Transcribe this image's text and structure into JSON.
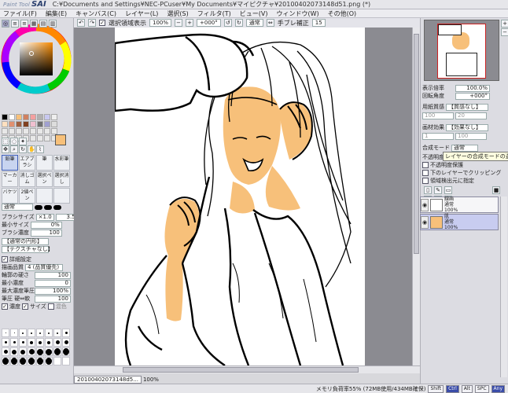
{
  "titlebar": {
    "logo_small": "Paint Tool",
    "logo_big": "SAI",
    "path": "C:¥Documents and Settings¥NEC-PCuser¥My Documents¥マイピクチャ¥20100402073148d51.png (*)"
  },
  "menu": [
    "ファイル(F)",
    "編集(E)",
    "キャンバス(C)",
    "レイヤー(L)",
    "選択(S)",
    "フィルタ(T)",
    "ビュー(V)",
    "ウィンドウ(W)",
    "その他(O)"
  ],
  "toolbar": {
    "selection_display_label": "選択領域表示",
    "zoom": "100%",
    "rotation": "+000°",
    "mode": "通常",
    "stabilizer_label": "手ブレ補正",
    "stabilizer_value": "15"
  },
  "left": {
    "brush_shape_label": "通常",
    "brush_size_label": "ブラシサイズ",
    "brush_size_mult": "×1.0",
    "brush_size_value": "3.5",
    "min_size_label": "最小サイズ",
    "min_size_value": "0%",
    "brush_density_label": "ブラシ濃度",
    "brush_density_value": "100",
    "texture_1": "【通常の円形】",
    "texture_2": "【テクスチャなし】",
    "detail_label": "詳細設定",
    "quality_label": "描画品質",
    "quality_value": "4 (品質優先)",
    "edge_label": "輪郭の硬さ",
    "edge_value": "100",
    "min_density_label": "最小濃度",
    "min_density_value": "0",
    "max_density_label": "最大濃度筆圧",
    "max_density_value": "100%",
    "pressure_label": "筆圧 硬⇔軟",
    "pressure_value": "100",
    "pressure_density": "濃度",
    "pressure_size": "サイズ",
    "pressure_blend": "混色",
    "tools": [
      "鉛筆",
      "エアブラシ",
      "筆",
      "水彩筆",
      "マーカー",
      "消しゴム",
      "選択ペン",
      "選択消し",
      "バケツ",
      "2値ペン",
      "",
      ""
    ],
    "brush_sizes": [
      "0.7",
      "0.8",
      "1",
      "1.5",
      "2",
      "2.3",
      "2.6",
      "3",
      "3.5",
      "4",
      "5",
      "6",
      "7",
      "8",
      "9",
      "10",
      "12",
      "14",
      "16",
      "20",
      "25",
      "30",
      "35",
      "40",
      "50",
      "60",
      "70",
      "80",
      "100",
      "120",
      "",
      ""
    ]
  },
  "right": {
    "zoom_label": "表示倍率",
    "zoom_value": "100.0%",
    "angle_label": "回転角度",
    "angle_value": "+000°",
    "texture_label": "用紙質感",
    "texture_value": "【質感なし】",
    "effect_label": "画材効果",
    "effect_value": "【効果なし】",
    "blend_label": "合成モード",
    "blend_value": "通常",
    "tooltip": "レイヤーの合成モードの選択",
    "opacity_label": "不透明度",
    "preserve_opacity": "不透明度保護",
    "clip_group": "下のレイヤーでクリッピング",
    "ref_source": "領域検出元に指定",
    "layers": [
      {
        "name": "線画",
        "mode": "通常",
        "opacity": "100%"
      },
      {
        "name": "肌",
        "mode": "通常",
        "opacity": "100%"
      }
    ]
  },
  "doc": {
    "name": "20100402073148d5...",
    "zoom": "100%"
  },
  "status": {
    "memory": "メモリ負荷率55% (72MB使用/434MB確保)",
    "keys": [
      "Shift",
      "Ctrl",
      "Alt",
      "SPC",
      "Any"
    ]
  },
  "colors": {
    "skin": "#f7c07a",
    "accent": "#3a4ca8",
    "fg_swatch": "#f7c07a"
  }
}
